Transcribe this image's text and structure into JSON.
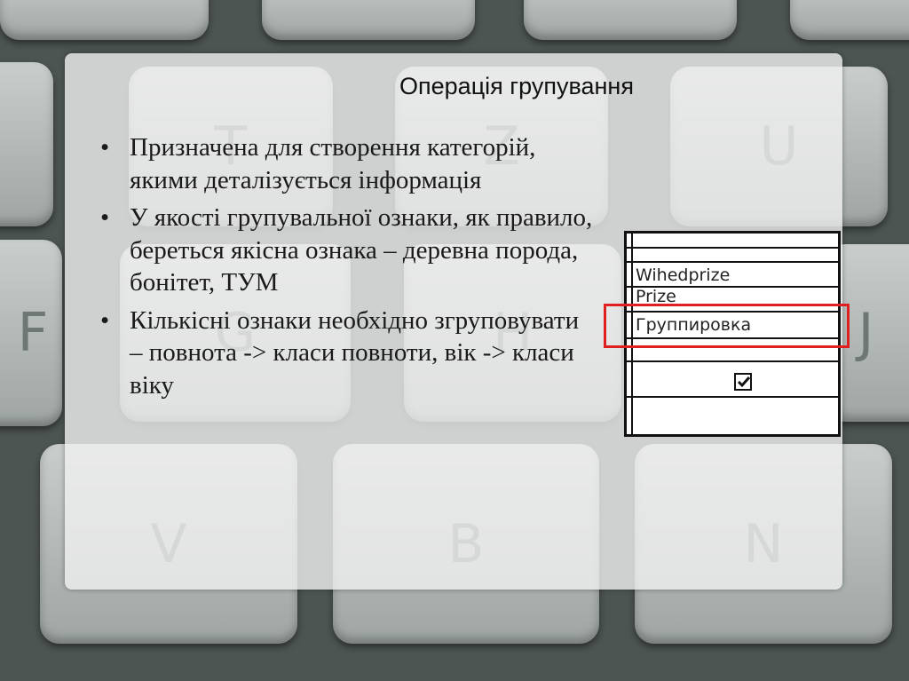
{
  "slide": {
    "title": "Операція групування",
    "bullet_marker": "•",
    "bullets": [
      "Призначена для створення категорій, якими деталізується інформація",
      "У якості групувальної ознаки, як правило, береться якісна ознака – деревна порода, бонітет, ТУМ",
      "Кількісні ознаки необхідно згруповувати – повнота -> класи повноти, вік -> класи віку"
    ]
  },
  "grid_image": {
    "rows": [
      "Wihedprize",
      "Prize",
      "Группировка"
    ],
    "checkbox_checked": true,
    "highlight_color": "#e02020"
  },
  "background": {
    "key_letters": [
      "T",
      "Z",
      "U",
      "F",
      "G",
      "H",
      "J",
      "V",
      "B",
      "N"
    ]
  }
}
